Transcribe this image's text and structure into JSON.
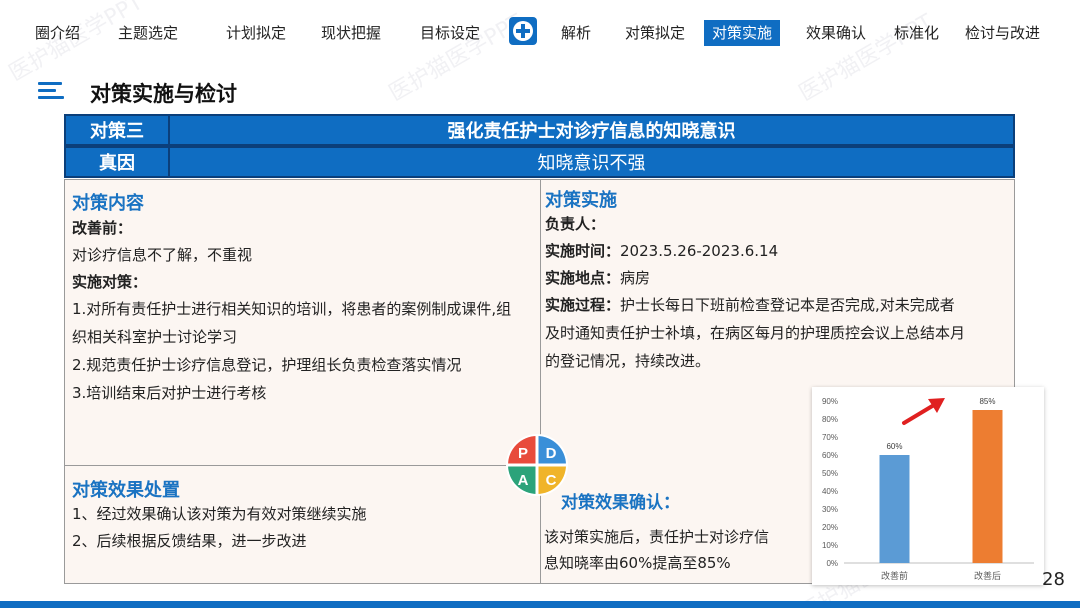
{
  "nav": {
    "items": [
      "圈介绍",
      "主题选定",
      "计划拟定",
      "现状把握",
      "目标设定",
      "解析",
      "对策拟定",
      "对策实施",
      "效果确认",
      "标准化",
      "检讨与改进"
    ],
    "active_index": 7
  },
  "page": {
    "title": "对策实施与检讨",
    "page_number": "28",
    "accent_color": "#0f6dc2"
  },
  "header": {
    "row1": {
      "label": "对策三",
      "value": "强化责任护士对诊疗信息的知晓意识"
    },
    "row2": {
      "label": "真因",
      "value": "知晓意识不强"
    }
  },
  "content": {
    "title": "对策内容",
    "before_label": "改善前：",
    "before_text": "对诊疗信息不了解，不重视",
    "measures_label": "实施对策：",
    "measures": [
      "1.对所有责任护士进行相关知识的培训，将患者的案例制成课件,组",
      "织相关科室护士讨论学习",
      "2.规范责任护士诊疗信息登记，护理组长负责检查落实情况",
      "3.培训结束后对护士进行考核"
    ]
  },
  "implementation": {
    "title": "对策实施",
    "responsible_label": "负责人：",
    "time_label": "实施时间：",
    "time_value": "2023.5.26-2023.6.14",
    "place_label": "实施地点：",
    "place_value": "病房",
    "process_label": "实施过程：",
    "process_lines": [
      "护士长每日下班前检查登记本是否完成,对未完成者",
      "及时通知责任护士补填，在病区每月的护理质控会议上总结本月",
      "的登记情况，持续改进。"
    ]
  },
  "disposal": {
    "title": "对策效果处置",
    "items": [
      "1、经过效果确认该对策为有效对策继续实施",
      "2、后续根据反馈结果，进一步改进"
    ]
  },
  "confirmation": {
    "title": "对策效果确认：",
    "lines": [
      "该对策实施后，责任护士对诊疗信",
      "息知晓率由60%提高至85%"
    ]
  },
  "pdca": {
    "letters": [
      "P",
      "D",
      "A",
      "C"
    ],
    "colors": {
      "P": "#e84b3c",
      "D": "#3a8fd8",
      "A": "#2ba37a",
      "C": "#f0b429"
    }
  },
  "watermark": "医护猫医学PPT",
  "chart_data": {
    "type": "bar",
    "categories": [
      "改善前",
      "改善后"
    ],
    "values": [
      60,
      85
    ],
    "value_labels": [
      "60%",
      "85%"
    ],
    "ylim": [
      0,
      90
    ],
    "yticks": [
      "0%",
      "10%",
      "20%",
      "30%",
      "40%",
      "50%",
      "60%",
      "70%",
      "80%",
      "90%"
    ],
    "bar_colors": [
      "#5b9bd5",
      "#ed7d31"
    ],
    "arrow_color": "#e02020",
    "grid": false
  }
}
